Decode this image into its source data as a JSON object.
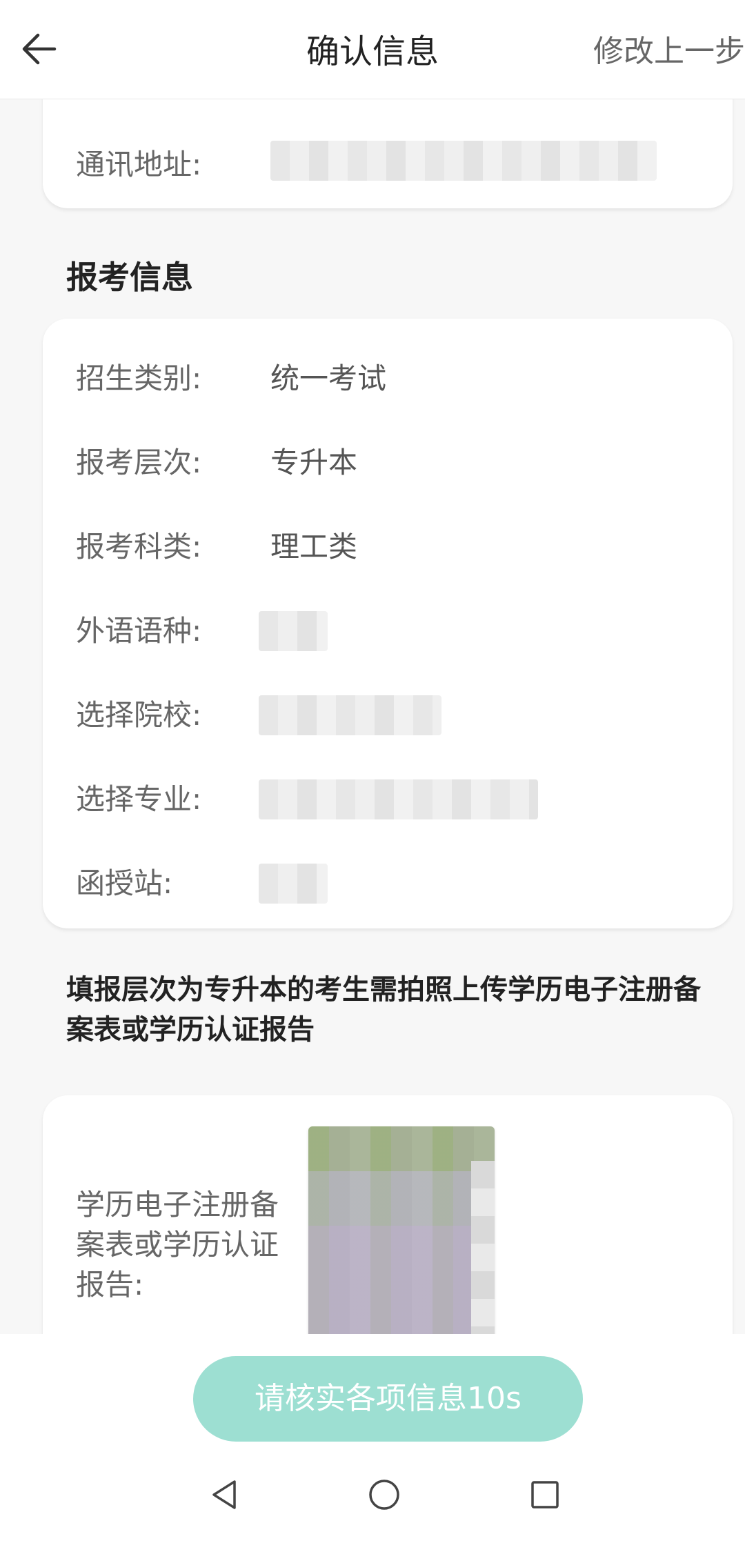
{
  "header": {
    "title": "确认信息",
    "action_label": "修改上一步",
    "back_icon": "arrow-left-icon"
  },
  "contact": {
    "address_label": "通讯地址:"
  },
  "apply_section": {
    "title": "报考信息",
    "rows": [
      {
        "label": "招生类别:",
        "value": "统一考试"
      },
      {
        "label": "报考层次:",
        "value": "专升本"
      },
      {
        "label": "报考科类:",
        "value": "理工类"
      },
      {
        "label": "外语语种:"
      },
      {
        "label": "选择院校:"
      },
      {
        "label": "选择专业:"
      },
      {
        "label": "函授站:"
      }
    ]
  },
  "document_section": {
    "notice": "填报层次为专升本的考生需拍照上传学历电子注册备案表或学历认证报告",
    "label": "学历电子注册备案表或学历认证报告:"
  },
  "confirm_button": {
    "label": "请核实各项信息10s",
    "color": "#9ddfd2"
  },
  "system_nav": {
    "back_icon": "triangle-back-icon",
    "home_icon": "circle-home-icon",
    "recents_icon": "square-recents-icon"
  }
}
